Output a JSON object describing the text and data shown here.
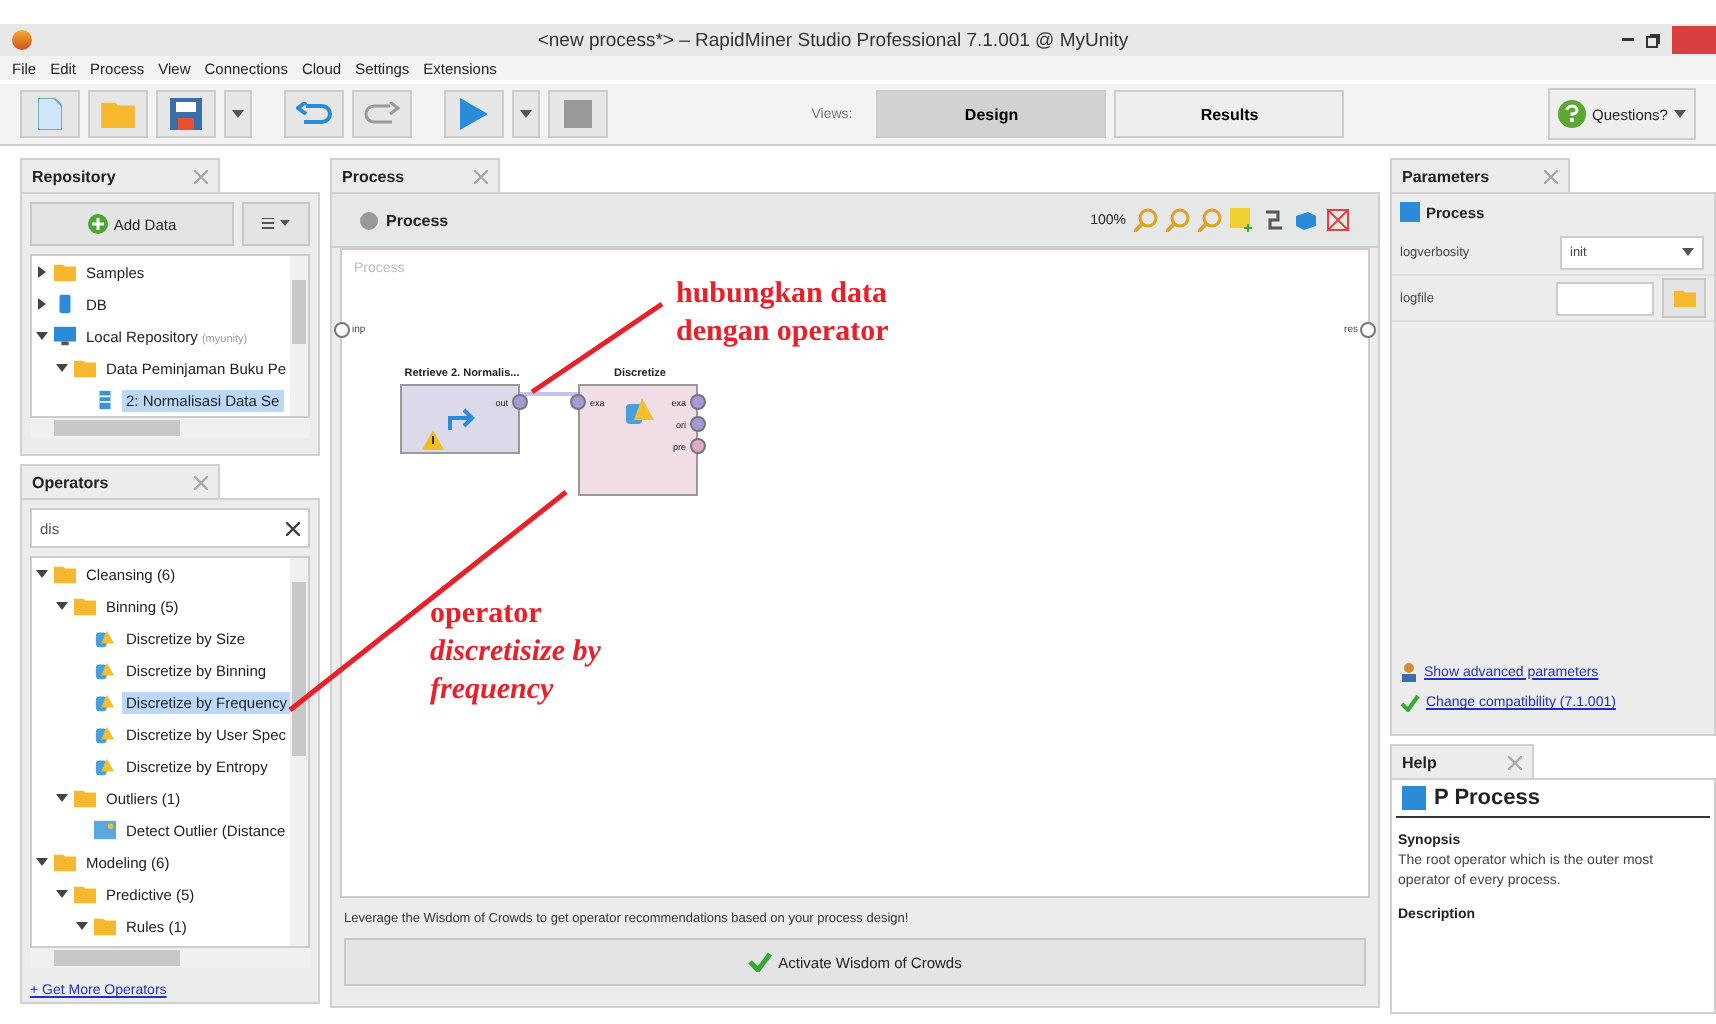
{
  "window": {
    "title": "<new process*> – RapidMiner Studio Professional 7.1.001 @ MyUnity"
  },
  "menu": [
    "File",
    "Edit",
    "Process",
    "View",
    "Connections",
    "Cloud",
    "Settings",
    "Extensions"
  ],
  "toolbar": {
    "views_label": "Views:",
    "views": [
      {
        "label": "Design",
        "selected": true
      },
      {
        "label": "Results",
        "selected": false
      }
    ],
    "questions": "Questions?"
  },
  "repository": {
    "tab": "Repository",
    "add_data": "Add Data",
    "tree": [
      {
        "label": "Samples",
        "kind": "folder",
        "expanded": false,
        "selected": false
      },
      {
        "label": "DB",
        "kind": "db",
        "expanded": false,
        "selected": false
      },
      {
        "label": "Local Repository",
        "note": "(myunity)",
        "kind": "monitor",
        "expanded": true,
        "selected": false,
        "children": [
          {
            "label": "Data Peminjaman Buku Pe",
            "kind": "folder",
            "expanded": true,
            "selected": false,
            "children": [
              {
                "label": "2: Normalisasi Data Se",
                "kind": "data",
                "selected": true
              }
            ]
          }
        ]
      }
    ]
  },
  "operators": {
    "tab": "Operators",
    "search": "dis",
    "tree": [
      {
        "label": "Cleansing (6)",
        "kind": "folder",
        "expanded": true,
        "selected": false,
        "children": [
          {
            "label": "Binning (5)",
            "kind": "folder",
            "expanded": true,
            "selected": false,
            "children": [
              {
                "label": "Discretize by Size",
                "kind": "operator",
                "selected": false
              },
              {
                "label": "Discretize by Binning",
                "kind": "operator",
                "selected": false
              },
              {
                "label": "Discretize by Frequency",
                "kind": "operator",
                "selected": true
              },
              {
                "label": "Discretize by User Spec",
                "kind": "operator",
                "selected": false
              },
              {
                "label": "Discretize by Entropy",
                "kind": "operator",
                "selected": false
              }
            ]
          },
          {
            "label": "Outliers (1)",
            "kind": "folder",
            "expanded": true,
            "selected": false,
            "children": [
              {
                "label": "Detect Outlier (Distance",
                "kind": "outlier",
                "selected": false
              }
            ]
          }
        ]
      },
      {
        "label": "Modeling (6)",
        "kind": "folder",
        "expanded": true,
        "selected": false,
        "children": [
          {
            "label": "Predictive (5)",
            "kind": "folder",
            "expanded": true,
            "selected": false,
            "children": [
              {
                "label": "Rules (1)",
                "kind": "folder",
                "expanded": true,
                "selected": false
              }
            ]
          }
        ]
      }
    ],
    "link": "+ Get More Operators"
  },
  "process": {
    "tab": "Process",
    "breadcrumb": "Process",
    "zoom": "100%",
    "canvas_label": "Process",
    "port_in": "inp",
    "port_out": "res",
    "nodes": [
      {
        "title": "Retrieve 2. Normalis...",
        "kind": "retrieve",
        "warning": true,
        "ports_out": [
          "out"
        ]
      },
      {
        "title": "Discretize",
        "kind": "operator",
        "warning": false,
        "ports_in": [
          "exa"
        ],
        "ports_out": [
          "exa",
          "ori",
          "pre"
        ]
      }
    ],
    "hint": "Leverage the Wisdom of Crowds to get operator recommendations based on your process design!",
    "button": "Activate Wisdom of Crowds"
  },
  "annotations": [
    {
      "text": "hubungkan data\ndengan operator"
    },
    {
      "text": "operator\n*discretisize by\nfrequency*"
    }
  ],
  "parameters": {
    "tab": "Parameters",
    "header": "Process",
    "params": [
      {
        "name": "logverbosity",
        "kind": "select",
        "value": "init"
      },
      {
        "name": "logfile",
        "kind": "file"
      }
    ],
    "links": [
      {
        "kind": "person",
        "text": "Show advanced parameters"
      },
      {
        "kind": "check",
        "text": "Change compatibility (7.1.001)"
      }
    ]
  },
  "help": {
    "tab": "Help",
    "title": "P Process",
    "synopsis_heading": "Synopsis",
    "synopsis": "The root operator which is the outer most operator of every process.",
    "description_heading": "Description"
  }
}
